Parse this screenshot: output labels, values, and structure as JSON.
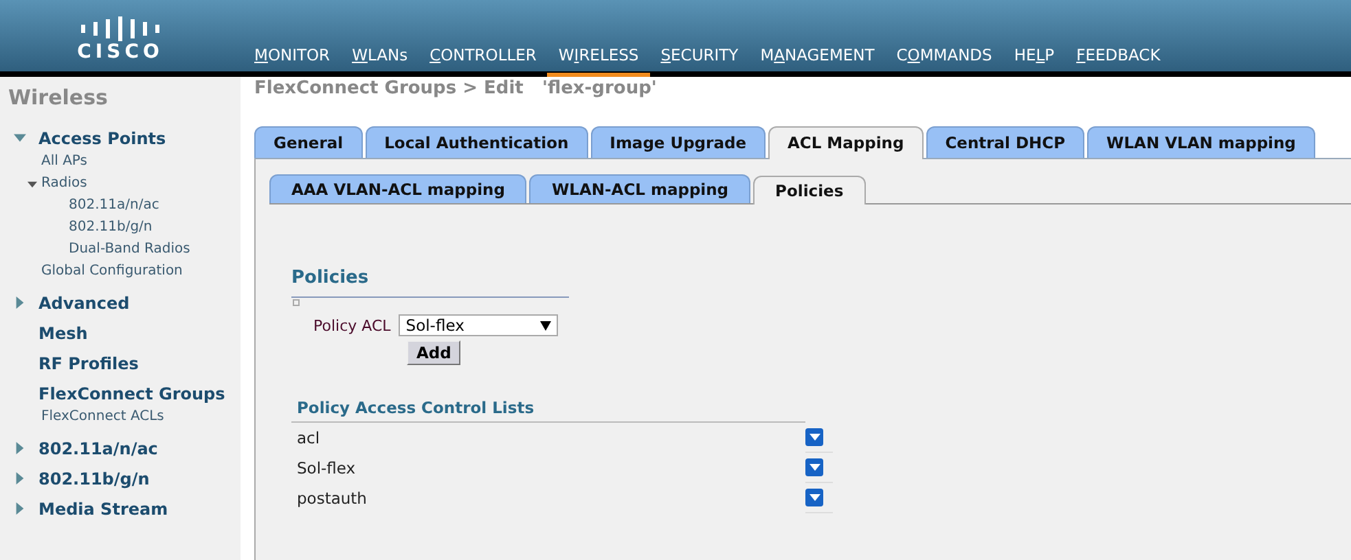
{
  "header": {
    "logo": "CISCO",
    "menu": [
      {
        "key": "M",
        "post": "ONITOR",
        "selected": false
      },
      {
        "key": "W",
        "post": "LANs",
        "selected": false
      },
      {
        "key": "C",
        "post": "ONTROLLER",
        "selected": false
      },
      {
        "pre": "W",
        "key": "I",
        "post": "RELESS",
        "selected": true
      },
      {
        "key": "S",
        "post": "ECURITY",
        "selected": false
      },
      {
        "pre": "M",
        "key": "A",
        "post": "NAGEMENT",
        "selected": false
      },
      {
        "pre": "C",
        "key": "O",
        "post": "MMANDS",
        "selected": false
      },
      {
        "pre": "HE",
        "key": "L",
        "post": "P",
        "selected": false
      },
      {
        "key": "F",
        "post": "EEDBACK",
        "selected": false
      }
    ]
  },
  "sidebar": {
    "title": "Wireless",
    "items": [
      {
        "label": "Access Points",
        "expanded": true,
        "children": [
          {
            "label": "All APs"
          },
          {
            "label": "Radios",
            "expanded": true,
            "children": [
              {
                "label": "802.11a/n/ac"
              },
              {
                "label": "802.11b/g/n"
              },
              {
                "label": "Dual-Band Radios"
              }
            ]
          },
          {
            "label": "Global Configuration"
          }
        ]
      },
      {
        "label": "Advanced",
        "expanded": false
      },
      {
        "label": "Mesh"
      },
      {
        "label": "RF Profiles"
      },
      {
        "label": "FlexConnect Groups",
        "children": [
          {
            "label": "FlexConnect ACLs"
          }
        ]
      },
      {
        "label": "802.11a/n/ac",
        "expanded": false
      },
      {
        "label": "802.11b/g/n",
        "expanded": false
      },
      {
        "label": "Media Stream",
        "expanded": false
      }
    ]
  },
  "page_title": "FlexConnect Groups > Edit   'flex-group'",
  "tabs": [
    {
      "label": "General",
      "selected": false
    },
    {
      "label": "Local Authentication",
      "selected": false
    },
    {
      "label": "Image Upgrade",
      "selected": false
    },
    {
      "label": "ACL Mapping",
      "selected": true
    },
    {
      "label": "Central DHCP",
      "selected": false
    },
    {
      "label": "WLAN VLAN mapping",
      "selected": false
    }
  ],
  "subtabs": [
    {
      "label": "AAA VLAN-ACL mapping",
      "selected": false
    },
    {
      "label": "WLAN-ACL mapping",
      "selected": false
    },
    {
      "label": "Policies",
      "selected": true
    }
  ],
  "policies": {
    "heading": "Policies",
    "policy_acl_label": "Policy ACL",
    "policy_acl_value": "Sol-flex",
    "add_button": "Add"
  },
  "acl_list": {
    "heading": "Policy Access Control Lists",
    "rows": [
      {
        "name": "acl"
      },
      {
        "name": "Sol-flex"
      },
      {
        "name": "postauth"
      }
    ]
  }
}
